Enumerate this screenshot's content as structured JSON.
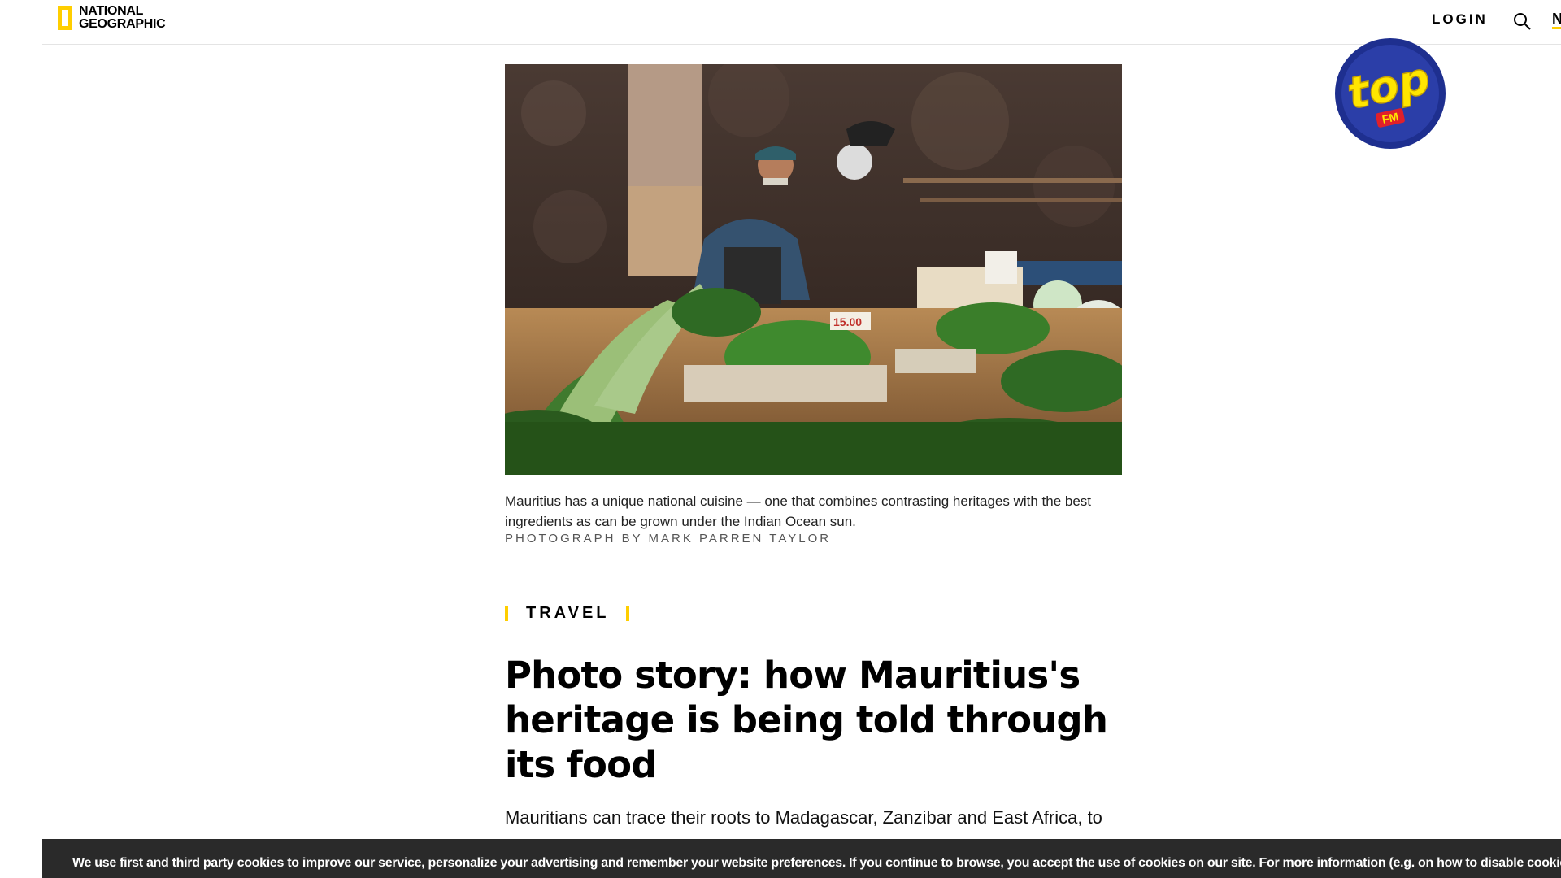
{
  "header": {
    "logo_line1": "NATIONAL",
    "logo_line2": "GEOGRAPHIC",
    "login_label": "LOGIN",
    "nav_edge_letter": "N"
  },
  "article": {
    "caption": "Mauritius has a unique national cuisine — one that combines contrasting heritages with the best ingredients as can be grown under the Indian Ocean sun.",
    "credit": "PHOTOGRAPH BY MARK PARREN TAYLOR",
    "section": "TRAVEL",
    "headline": "Photo story: how Mauritius's heritage is being told through its food",
    "lede": "Mauritians can trace their roots to Madagascar, Zanzibar and East Africa, to"
  },
  "cookie": {
    "text": "We use first and third party cookies to improve our service, personalize your advertising and remember your website preferences. If you continue to browse, you accept the use of cookies on our site. For more information (e.g. on how to disable cookies) v"
  },
  "badge": {
    "brand": "top",
    "sub": "FM"
  },
  "colors": {
    "accent_yellow": "#ffce00",
    "banner_bg": "#2a2a2a",
    "badge_blue": "#1e2f8f",
    "badge_yellow": "#ffe600",
    "badge_red": "#e0202a"
  },
  "icons": {
    "search": "search-icon",
    "logo": "yellow-border-logo-icon"
  }
}
